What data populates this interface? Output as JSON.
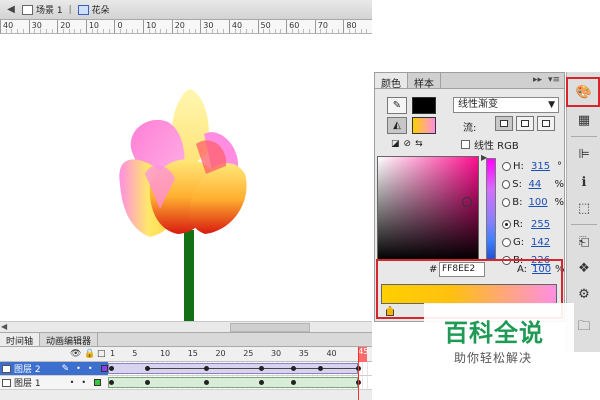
{
  "scenebar": {
    "scene_label": "场景 1",
    "symbol_label": "花朵"
  },
  "ruler": {
    "ticks": [
      "40",
      "30",
      "20",
      "10",
      "0",
      "10",
      "20",
      "30",
      "40",
      "50",
      "60",
      "70",
      "80"
    ]
  },
  "timeline": {
    "tabs": [
      "时间轴",
      "动画编辑器"
    ],
    "frame_numbers": [
      "1",
      "5",
      "10",
      "15",
      "20",
      "25",
      "30",
      "35",
      "40"
    ],
    "current_frame": "45",
    "layers": [
      {
        "name": "图层 2",
        "color": "#8a3ff0"
      },
      {
        "name": "图层 1",
        "color": "#39c739"
      }
    ]
  },
  "color_panel": {
    "tabs": [
      "颜色",
      "样本"
    ],
    "fill_type": "线性渐变",
    "flow_label": "流:",
    "linear_rgb_label": "线性 RGB",
    "hsb": [
      {
        "label": "H:",
        "value": "315",
        "unit": "°"
      },
      {
        "label": "S:",
        "value": "44",
        "unit": "%"
      },
      {
        "label": "B:",
        "value": "100",
        "unit": "%"
      }
    ],
    "rgb": [
      {
        "label": "R:",
        "value": "255"
      },
      {
        "label": "G:",
        "value": "142"
      },
      {
        "label": "B:",
        "value": "226"
      }
    ],
    "hex_hash": "#",
    "hex_value": "FF8EE2",
    "alpha_label": "A:",
    "alpha_value": "100",
    "alpha_unit": "%",
    "stroke_color": "#000000",
    "fill_gradient": [
      "#ffd000",
      "#ff8ee2"
    ]
  },
  "watermark": {
    "title": "百科全说",
    "subtitle": "助你轻松解决"
  }
}
